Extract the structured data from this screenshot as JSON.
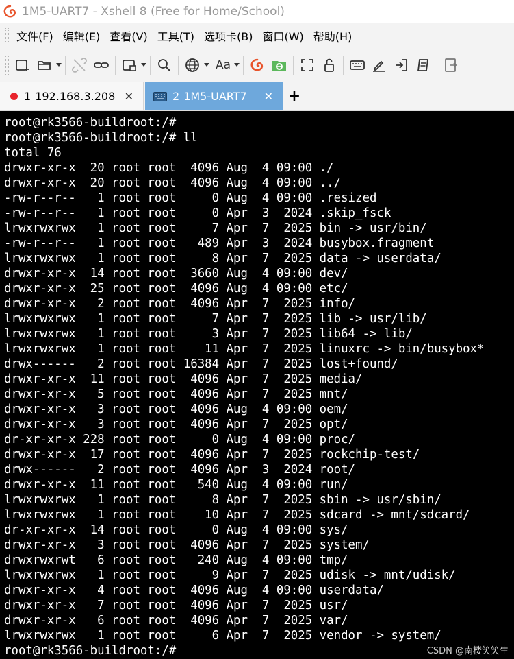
{
  "window": {
    "title": "1M5-UART7 - Xshell 8 (Free for Home/School)"
  },
  "menu": {
    "items": [
      "文件(F)",
      "编辑(E)",
      "查看(V)",
      "工具(T)",
      "选项卡(B)",
      "窗口(W)",
      "帮助(H)"
    ]
  },
  "toolbar": {
    "icons": [
      "new-session-icon",
      "open-folder-icon",
      "disconnect-icon",
      "reconnect-icon",
      "new-window-icon",
      "search-icon",
      "globe-icon",
      "font-icon",
      "xshell-icon",
      "xftp-icon",
      "fullscreen-icon",
      "lock-icon",
      "keyboard-icon",
      "compose-icon",
      "transfer-icon",
      "script-icon",
      "log-icon"
    ],
    "font_label": "Aa"
  },
  "tabs": [
    {
      "number": "1",
      "label": "192.168.3.208",
      "status_color": "#e8242c",
      "active": false
    },
    {
      "number": "2",
      "label": "1M5-UART7",
      "active": true
    }
  ],
  "terminal": {
    "lines": [
      "root@rk3566-buildroot:/#",
      "root@rk3566-buildroot:/# ll",
      "total 76",
      "drwxr-xr-x  20 root root  4096 Aug  4 09:00 ./",
      "drwxr-xr-x  20 root root  4096 Aug  4 09:00 ../",
      "-rw-r--r--   1 root root     0 Aug  4 09:00 .resized",
      "-rw-r--r--   1 root root     0 Apr  3  2024 .skip_fsck",
      "lrwxrwxrwx   1 root root     7 Apr  7  2025 bin -> usr/bin/",
      "-rw-r--r--   1 root root   489 Apr  3  2024 busybox.fragment",
      "lrwxrwxrwx   1 root root     8 Apr  7  2025 data -> userdata/",
      "drwxr-xr-x  14 root root  3660 Aug  4 09:00 dev/",
      "drwxr-xr-x  25 root root  4096 Aug  4 09:00 etc/",
      "drwxr-xr-x   2 root root  4096 Apr  7  2025 info/",
      "lrwxrwxrwx   1 root root     7 Apr  7  2025 lib -> usr/lib/",
      "lrwxrwxrwx   1 root root     3 Apr  7  2025 lib64 -> lib/",
      "lrwxrwxrwx   1 root root    11 Apr  7  2025 linuxrc -> bin/busybox*",
      "drwx------   2 root root 16384 Apr  7  2025 lost+found/",
      "drwxr-xr-x  11 root root  4096 Apr  7  2025 media/",
      "drwxr-xr-x   5 root root  4096 Apr  7  2025 mnt/",
      "drwxr-xr-x   3 root root  4096 Aug  4 09:00 oem/",
      "drwxr-xr-x   3 root root  4096 Apr  7  2025 opt/",
      "dr-xr-xr-x 228 root root     0 Aug  4 09:00 proc/",
      "drwxr-xr-x  17 root root  4096 Apr  7  2025 rockchip-test/",
      "drwx------   2 root root  4096 Apr  3  2024 root/",
      "drwxr-xr-x  11 root root   540 Aug  4 09:00 run/",
      "lrwxrwxrwx   1 root root     8 Apr  7  2025 sbin -> usr/sbin/",
      "lrwxrwxrwx   1 root root    10 Apr  7  2025 sdcard -> mnt/sdcard/",
      "dr-xr-xr-x  14 root root     0 Aug  4 09:00 sys/",
      "drwxr-xr-x   3 root root  4096 Apr  7  2025 system/",
      "drwxrwxrwt   6 root root   240 Aug  4 09:00 tmp/",
      "lrwxrwxrwx   1 root root     9 Apr  7  2025 udisk -> mnt/udisk/",
      "drwxr-xr-x   4 root root  4096 Aug  4 09:00 userdata/",
      "drwxr-xr-x   7 root root  4096 Apr  7  2025 usr/",
      "drwxr-xr-x   6 root root  4096 Apr  7  2025 var/",
      "lrwxrwxrwx   1 root root     6 Apr  7  2025 vendor -> system/",
      "root@rk3566-buildroot:/#"
    ]
  },
  "watermark": "CSDN @南楼笑笑生",
  "colors": {
    "terminal_bg": "#000000",
    "terminal_fg": "#ffffff",
    "active_tab": "#6ea8dc",
    "chrome_bg": "#f3f3f3"
  }
}
